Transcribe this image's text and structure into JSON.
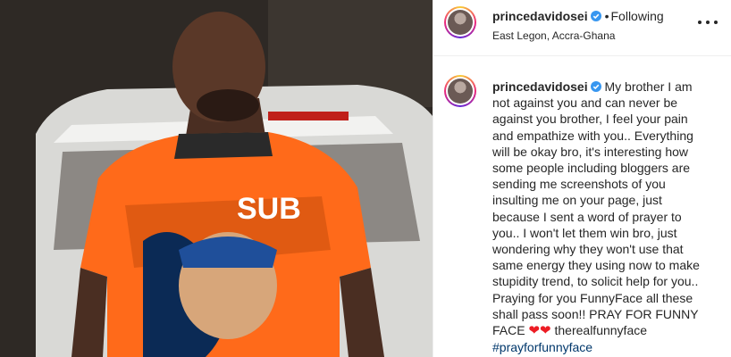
{
  "post": {
    "header": {
      "username": "princedavidosei",
      "dot": "•",
      "follow_status": "Following",
      "location": "East Legon, Accra-Ghana"
    },
    "caption": {
      "username": "princedavidosei",
      "text": "My brother I am not against you and can never be against you brother, I feel your pain and empathize with you.. Everything will be okay bro, it's interesting how some people including bloggers are sending me screenshots of you insulting me on your page, just because I sent a word of prayer to you.. I won't let them win bro, just wondering why they won't use that same energy they using now to make stupidity trend, to solicit help for you.. Praying for you FunnyFace all these shall pass soon!! PRAY FOR FUNNY FACE",
      "hearts": "❤❤",
      "mention": "therealfunnyface",
      "hashtag": "#prayforfunnyface"
    },
    "colors": {
      "verified_badge": "#3897f0",
      "hashtag": "#00376b",
      "heart": "#ed1c24"
    },
    "icons": {
      "more": "more-options-icon",
      "verified": "verified-badge-icon"
    }
  }
}
